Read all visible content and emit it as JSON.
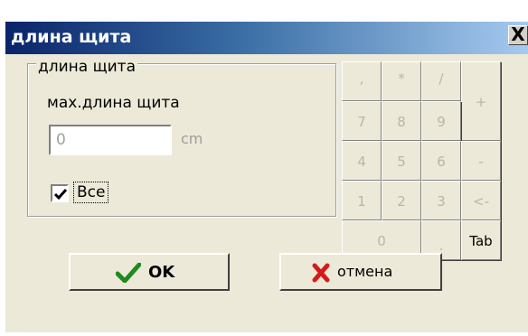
{
  "window": {
    "title": "длина щита",
    "close_label": "X"
  },
  "group": {
    "legend": "длина щита",
    "field_label": "мах.длина щита",
    "input_value": "0",
    "unit": "cm",
    "checkbox_checked": true,
    "checkbox_label": "Все"
  },
  "keypad": {
    "keys": [
      ",",
      "*",
      "/",
      "+",
      "7",
      "8",
      "9",
      "4",
      "5",
      "6",
      "-",
      "1",
      "2",
      "3",
      "<-",
      "0",
      ".",
      "Tab"
    ]
  },
  "buttons": {
    "ok_label": "OK",
    "cancel_label": "отмена"
  },
  "colors": {
    "title_gradient_start": "#0a246a",
    "title_gradient_end": "#a6caf0",
    "check_green": "#1e8a1e",
    "cancel_red": "#d41a1a",
    "face": "#ece9d8"
  },
  "icons": {
    "ok": "checkmark-icon",
    "cancel": "x-icon",
    "checkbox": "check-icon"
  }
}
